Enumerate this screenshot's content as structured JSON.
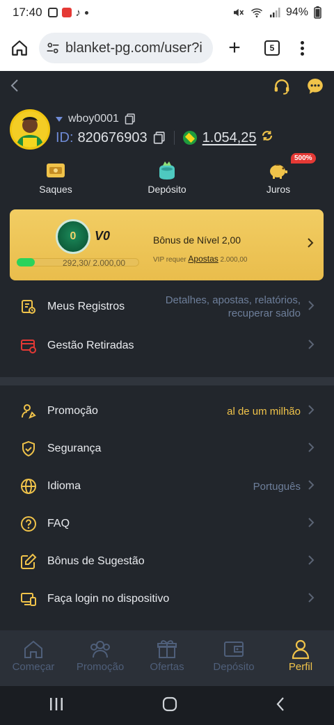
{
  "status_bar": {
    "time": "17:40",
    "battery": "94%"
  },
  "browser": {
    "url": "blanket-pg.com/user?i",
    "tab_count": "5"
  },
  "profile": {
    "username": "wboy0001",
    "id_label": "ID:",
    "id_value": "820676903",
    "balance": "1.054,25"
  },
  "quick_actions": [
    {
      "label": "Saques",
      "icon": "withdraw-icon"
    },
    {
      "label": "Depósito",
      "icon": "deposit-icon"
    },
    {
      "label": "Juros",
      "icon": "piggy-bank-icon",
      "badge": "500%"
    }
  ],
  "vip": {
    "medal_level": "0",
    "level": "V0",
    "progress_text": "292,30/ 2.000,00",
    "progress_fraction": 0.146,
    "bonus_text": "Bônus de Nível 2,00",
    "requirement_prefix": "VIP requer",
    "requirement_link": "Apostas",
    "requirement_value": "2.000,00"
  },
  "menu_section_1": [
    {
      "label": "Meus Registros",
      "desc_line1": "Detalhes, apostas, relatórios,",
      "desc_line2": "recuperar saldo",
      "icon": "records-icon"
    },
    {
      "label": "Gestão Retiradas",
      "icon": "withdraw-management-icon"
    }
  ],
  "menu_section_2": [
    {
      "label": "Promoção",
      "desc": "al de um milhão",
      "icon": "promotion-icon"
    },
    {
      "label": "Segurança",
      "icon": "shield-icon"
    },
    {
      "label": "Idioma",
      "desc": "Português",
      "icon": "globe-icon"
    },
    {
      "label": "FAQ",
      "icon": "question-icon"
    },
    {
      "label": "Bônus de Sugestão",
      "icon": "edit-icon"
    },
    {
      "label": "Faça login no dispositivo",
      "icon": "devices-icon"
    }
  ],
  "tab_bar": [
    {
      "label": "Começar",
      "icon": "home-icon"
    },
    {
      "label": "Promoção",
      "icon": "promotion-tab-icon"
    },
    {
      "label": "Ofertas",
      "icon": "gift-icon"
    },
    {
      "label": "Depósito",
      "icon": "wallet-icon"
    },
    {
      "label": "Perfil",
      "icon": "profile-icon",
      "active": true
    }
  ],
  "colors": {
    "accent": "#f0c34a",
    "background": "#22262c",
    "vip_card": "#efc65a",
    "progress": "#2bd35b"
  }
}
